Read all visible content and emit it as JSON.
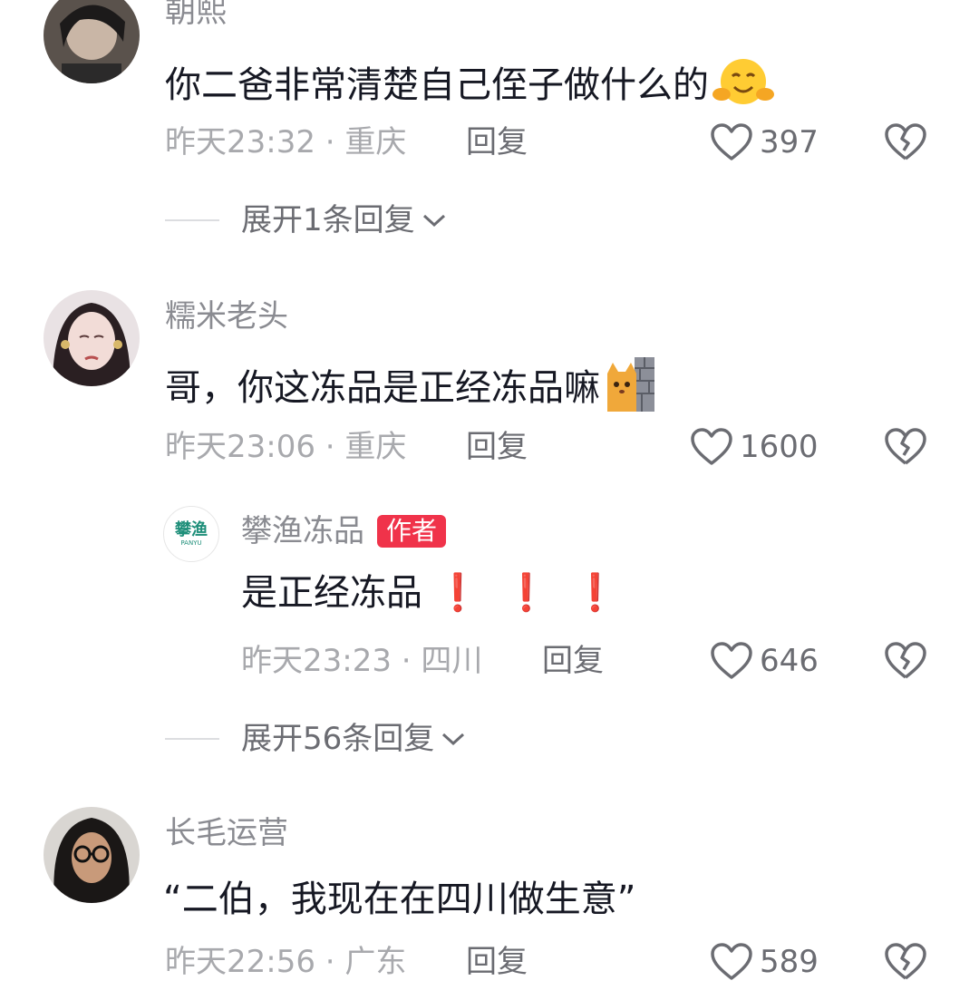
{
  "comments": [
    {
      "username": "朝熙",
      "text": "你二爸非常清楚自己侄子做什么的",
      "emoji": "hug-emoji",
      "time": "昨天23:32",
      "location": "重庆",
      "reply_label": "回复",
      "likes": "397",
      "expand": "展开1条回复"
    },
    {
      "username": "糯米老头",
      "text": "哥，你这冻品是正经冻品嘛",
      "emoji": "cat-peek-emoji",
      "time": "昨天23:06",
      "location": "重庆",
      "reply_label": "回复",
      "likes": "1600",
      "reply": {
        "username": "攀渔冻品",
        "author_tag": "作者",
        "avatar_text": "攀渔",
        "avatar_subtext": "PANYU",
        "text": "是正经冻品",
        "marks": "❗ ❗ ❗",
        "time": "昨天23:23",
        "location": "四川",
        "reply_label": "回复",
        "likes": "646"
      },
      "expand": "展开56条回复"
    },
    {
      "username": "长毛运营",
      "text": "“二伯，我现在在四川做生意”",
      "time": "昨天22:56",
      "location": "广东",
      "reply_label": "回复",
      "likes": "589"
    }
  ],
  "colors": {
    "author_tag": "#f0334a",
    "brand_green": "#1f8f7a"
  }
}
